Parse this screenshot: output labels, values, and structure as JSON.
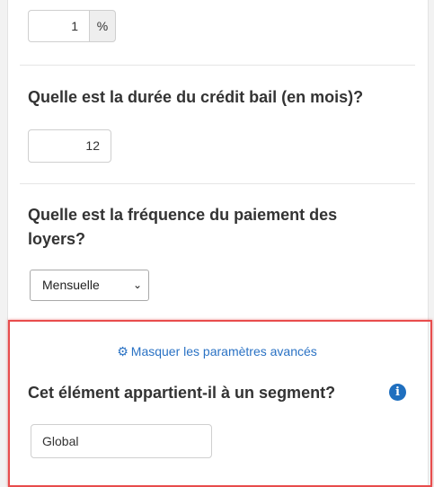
{
  "fields": {
    "percent_value": "1",
    "percent_unit": "%",
    "duration_question": "Quelle est la durée du crédit bail (en mois)?",
    "duration_value": "12",
    "frequency_question": "Quelle est la fréquence du paiement des loyers?",
    "frequency_selected": "Mensuelle"
  },
  "advanced": {
    "toggle_label": "Masquer les paramètres avancés",
    "segment_question": "Cet élément appartient-il à un segment?",
    "segment_value": "Global",
    "info_icon": "info-circle-icon",
    "gear_icon": "gear-icon"
  },
  "colors": {
    "link": "#2a72c4",
    "highlight_border": "#e84c4c",
    "info_icon": "#1f6fbf"
  }
}
